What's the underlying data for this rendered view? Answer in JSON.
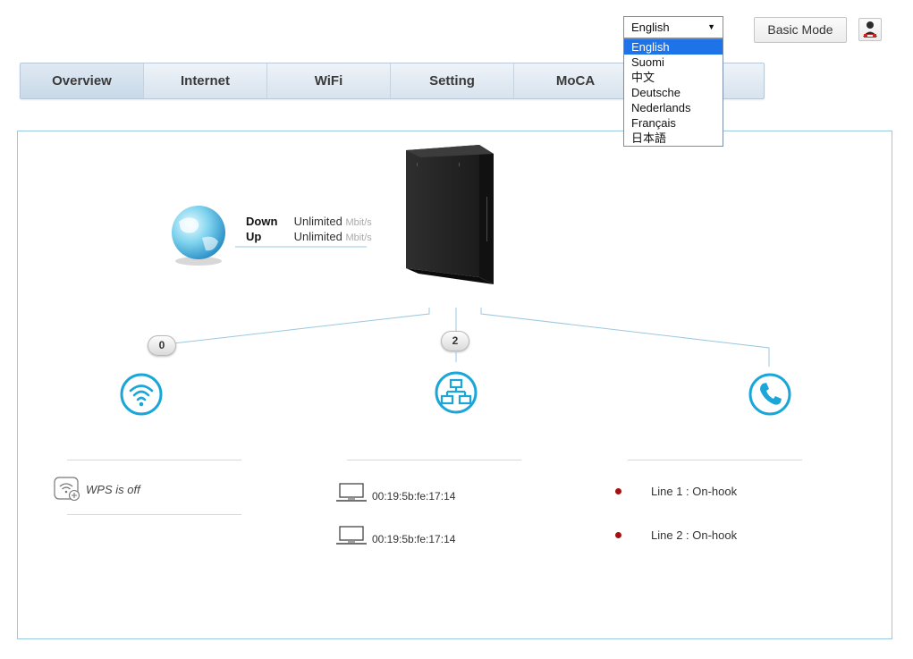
{
  "language": {
    "selected": "English",
    "options": [
      "English",
      "Suomi",
      "中文",
      "Deutsche",
      "Nederlands",
      "Français",
      "日本語"
    ]
  },
  "header": {
    "basic_mode_label": "Basic Mode",
    "user_icon": "user-icon"
  },
  "tabs": [
    {
      "label": "Overview",
      "active": true
    },
    {
      "label": "Internet"
    },
    {
      "label": "WiFi"
    },
    {
      "label": "Setting"
    },
    {
      "label": "MoCA"
    },
    {
      "label": ""
    }
  ],
  "internet": {
    "down_label": "Down",
    "down_value": "Unlimited",
    "up_label": "Up",
    "up_value": "Unlimited",
    "unit": "Mbit/s",
    "icon": "globe-icon"
  },
  "wifi": {
    "count": "0",
    "icon": "wifi-icon",
    "wps_icon": "wps-icon",
    "wps_status": "WPS is off"
  },
  "lan": {
    "count": "2",
    "icon": "network-icon",
    "devices": [
      {
        "mac": "00:19:5b:fe:17:14",
        "icon": "laptop-icon"
      },
      {
        "mac": "00:19:5b:fe:17:14",
        "icon": "laptop-icon"
      }
    ]
  },
  "phone": {
    "icon": "phone-icon",
    "lines": [
      {
        "label": "Line 1 : On-hook"
      },
      {
        "label": "Line 2 : On-hook"
      }
    ]
  },
  "colors": {
    "accent": "#1ba6d9",
    "status_dot": "#a51010",
    "selected_option": "#1e73e8"
  }
}
